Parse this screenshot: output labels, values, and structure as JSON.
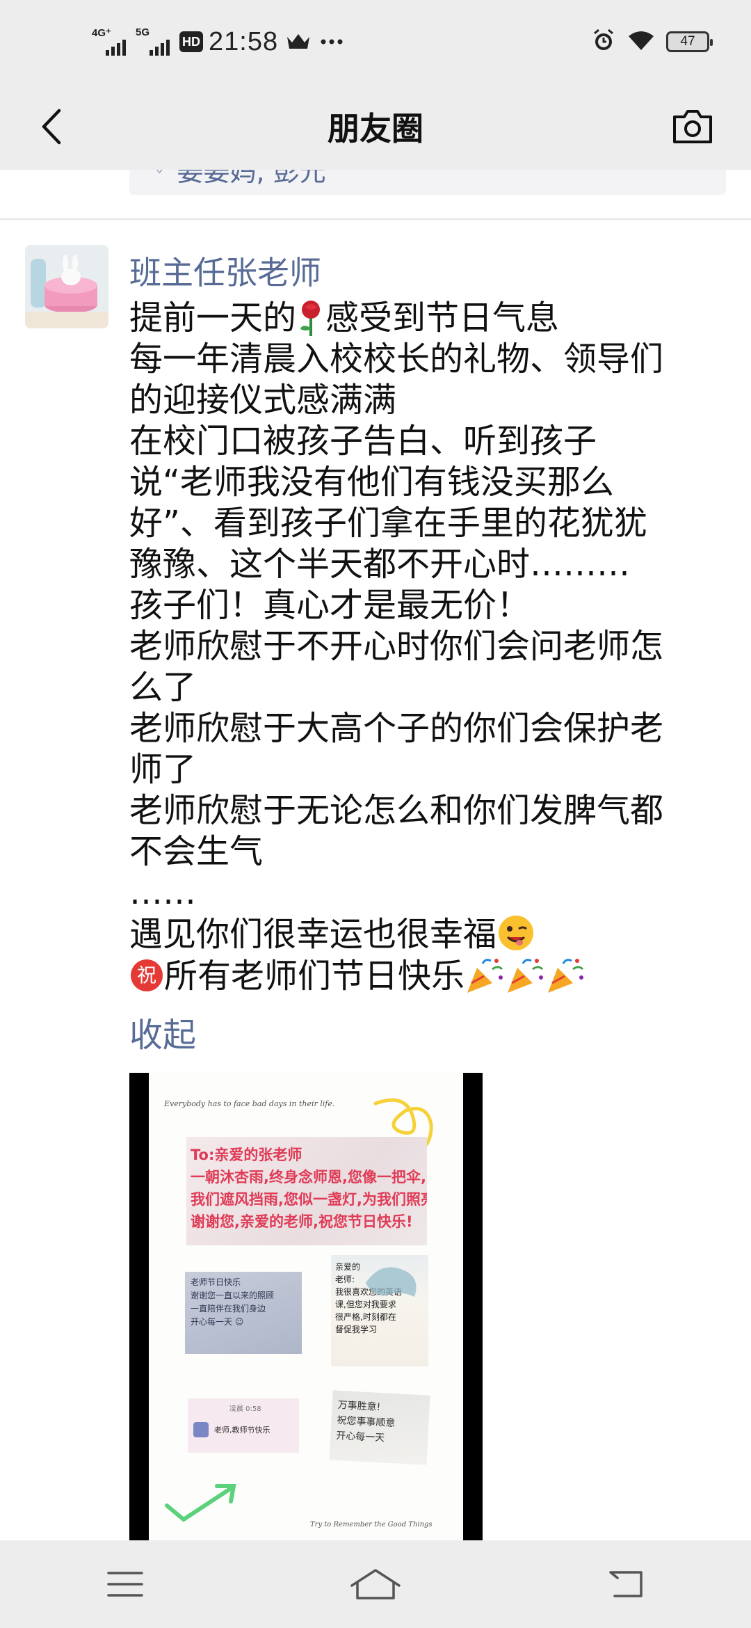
{
  "status_bar": {
    "sim1_label": "4G⁺",
    "sim2_label": "5G",
    "hd_label": "HD",
    "time": "21:58",
    "battery": "47",
    "icons": [
      "crown-icon",
      "more-dots-icon",
      "alarm-icon",
      "wifi-icon",
      "battery-icon"
    ]
  },
  "header": {
    "title": "朋友圈",
    "back_icon": "chevron-left-icon",
    "camera_icon": "camera-icon"
  },
  "previous_post": {
    "likes_icon": "heart-icon",
    "likes_text": "姜姜妈, 彭元"
  },
  "post": {
    "author": "班主任张老师",
    "avatar_icon": "bunny-cake-avatar",
    "lines": [
      "每一年清晨入校校长的礼物、领导们",
      "的迎接仪式感满满",
      "在校门口被孩子告白、听到孩子",
      "说“老师我没有他们有钱没买那么",
      "好”、看到孩子们拿在手里的花犹犹",
      "豫豫、这个半天都不开心时………",
      "孩子们！真心才是最无价！",
      "老师欣慰于不开心时你们会问老师怎",
      "么了",
      "老师欣慰于大高个子的你们会保护老",
      "师了",
      "老师欣慰于无论怎么和你们发脾气都",
      "不会生气",
      "……"
    ],
    "line1_before": "提前一天的",
    "line1_after": "感受到节日气息",
    "line_lucky": "遇见你们很幸运也很幸福",
    "line_wish": "所有老师们节日快乐",
    "emoji": {
      "rose": "rose-emoji",
      "wink": "wink-emoji",
      "zhu": "祝",
      "party": "party-popper-emoji"
    },
    "collapse_label": "收起",
    "image": {
      "caption_top": "Everybody has to face bad days in their life.",
      "caption_bottom": "Try to Remember the Good Things",
      "card_pink_lines": [
        "To:亲爱的张老师",
        "一朝沐杏雨,终身念师恩,您像一把伞,",
        "我们遮风挡雨,您似一盏灯,为我们照亮",
        "谢谢您,亲爱的老师,祝您节日快乐!"
      ],
      "card_blue_lines": [
        "老师节日快乐",
        "谢谢您一直以来的照顾",
        "一直陪伴在我们身边",
        "开心每一天 ☺"
      ],
      "card_note_lines": [
        "亲爱的",
        "老师:",
        "",
        "我很喜欢您的英语",
        "课,但您对我要求",
        "很严格,时刻都在",
        "督促我学习"
      ],
      "chat_time": "凌晨 0:58",
      "chat_text": "老师,教师节快乐",
      "card_sticky_lines": [
        "万事胜意!",
        "祝您事事顺意",
        "开心每一天"
      ]
    }
  },
  "nav": {
    "menu_icon": "menu-icon",
    "home_icon": "home-icon",
    "back_icon": "back-icon"
  }
}
